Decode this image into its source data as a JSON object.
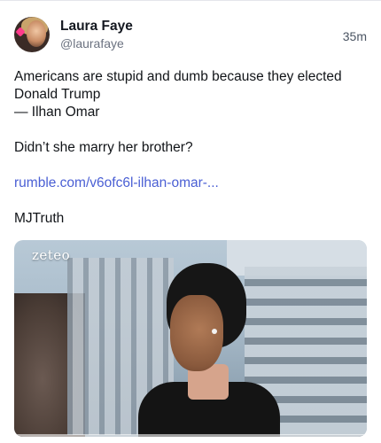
{
  "post": {
    "author_name": "Laura Faye",
    "author_handle": "@laurafaye",
    "timestamp": "35m",
    "lines": {
      "l1": "Americans are stupid and dumb because they elected",
      "l2": "Donald Trump",
      "l3": "— Ilhan Omar",
      "l4": "Didn’t she marry her brother?",
      "link": "rumble.com/v6ofc6l-ilhan-omar-...",
      "l5": "MJTruth"
    },
    "media": {
      "watermark": "zeteo"
    }
  },
  "colors": {
    "link": "#4a5fd4",
    "text": "#111418",
    "muted": "#6b7280"
  }
}
